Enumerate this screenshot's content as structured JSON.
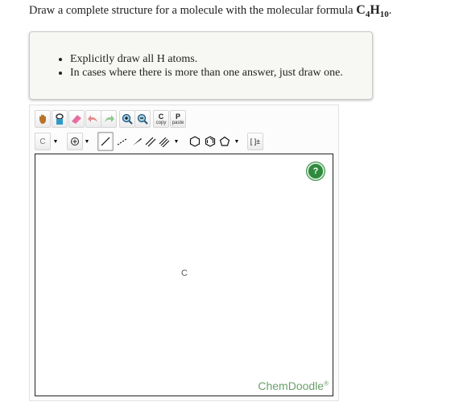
{
  "question": {
    "prefix": "Draw a complete structure for a molecule with the molecular formula ",
    "formula_c": "C",
    "formula_c_sub": "4",
    "formula_h": "H",
    "formula_h_sub": "10",
    "suffix": "."
  },
  "hints": [
    "Explicitly draw all H atoms.",
    "In cases where there is more than one answer, just draw one."
  ],
  "toolbar": {
    "copy_label_top": "C",
    "copy_label_bottom": "copy",
    "paste_label_top": "P",
    "paste_label_bottom": "paste",
    "element_label": "C",
    "bracket_label": "[ ]±"
  },
  "canvas": {
    "atom_label": "C",
    "help_label": "?",
    "brand": "ChemDoodle",
    "brand_mark": "®"
  },
  "colors": {
    "help_green": "#2f8a3d",
    "brand_green": "#6aa06a"
  }
}
